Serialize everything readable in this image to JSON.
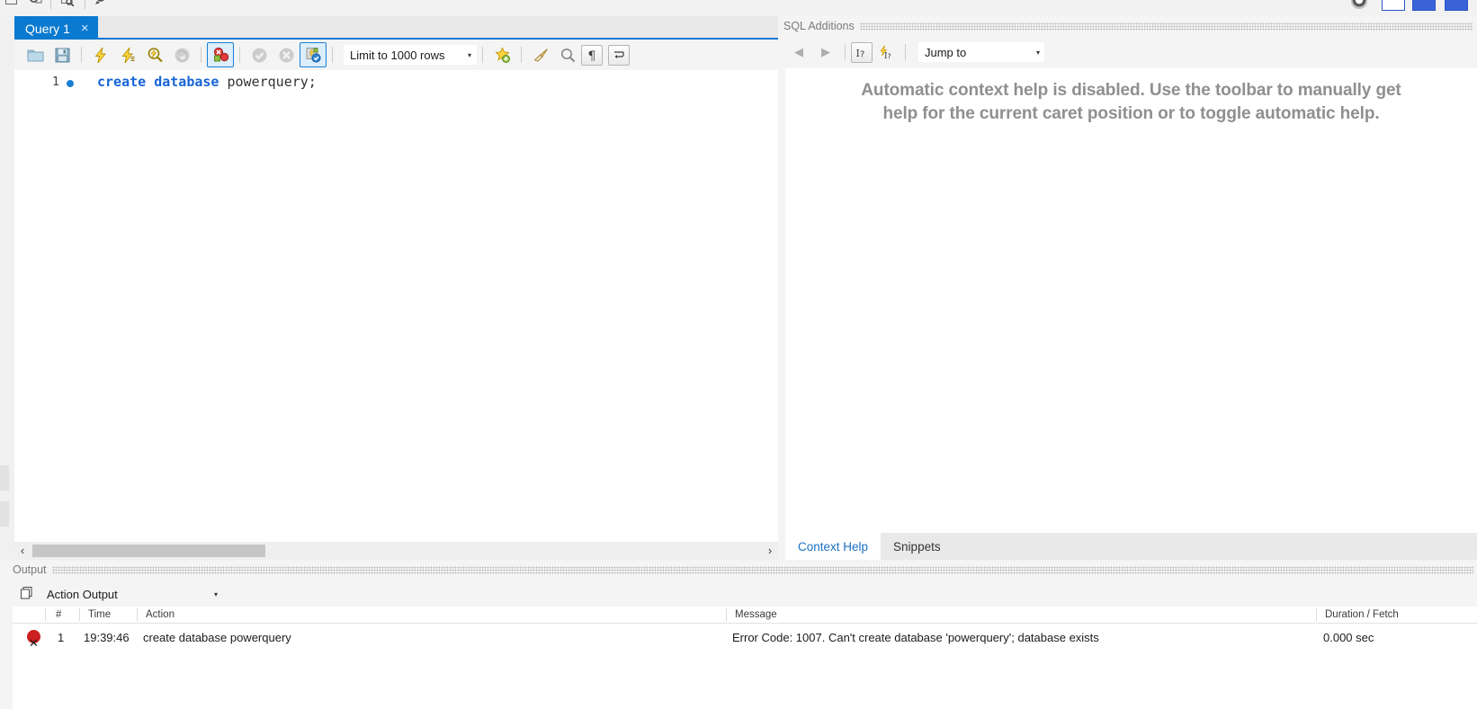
{
  "window": {
    "top_toolbar_icons": [
      "open-icon",
      "save-icon",
      "inspect-icon",
      "search-icon"
    ],
    "window_buttons": [
      "restore-button",
      "maximize-button"
    ]
  },
  "editor_tabs": [
    {
      "label": "Query 1",
      "close": "×",
      "active": true
    }
  ],
  "query_toolbar": {
    "buttons": [
      {
        "name": "open-sql-script-icon",
        "title": "Open a SQL script file"
      },
      {
        "name": "save-script-icon",
        "title": "Save script"
      },
      {
        "name": "execute-statement-icon",
        "title": "Execute"
      },
      {
        "name": "execute-current-statement-icon",
        "title": "Execute current statement"
      },
      {
        "name": "explain-query-icon",
        "title": "Explain current statement"
      },
      {
        "name": "stop-execution-icon",
        "title": "Stop"
      },
      {
        "name": "toggle-stop-on-error-icon",
        "title": "Toggle whether execution should stop on errors",
        "selected": true
      },
      {
        "name": "commit-icon",
        "title": "Commit"
      },
      {
        "name": "rollback-icon",
        "title": "Rollback"
      },
      {
        "name": "toggle-autocommit-icon",
        "title": "Toggle auto-commit mode",
        "selected": true
      },
      {
        "name": "beautify-query-icon",
        "title": "Beautify/reformat the SQL script"
      },
      {
        "name": "find-icon",
        "title": "Show the Find panel"
      },
      {
        "name": "invisible-chars-icon",
        "title": "Toggle invisible characters"
      },
      {
        "name": "wrap-lines-icon",
        "title": "Toggle wrapping of long lines"
      }
    ],
    "limit_selector": {
      "value": "Limit to 1000 rows",
      "caret": "▾"
    }
  },
  "sql_editor": {
    "line_number": "1",
    "code_keywords": "create database",
    "code_identifier": " powerquery;"
  },
  "scrollbar": {
    "left_arrow": "‹",
    "right_arrow": "›"
  },
  "sql_additions": {
    "title": "SQL Additions",
    "toolbar": {
      "back": "◀",
      "forward": "▶",
      "context_help_icon": "context-help-icon",
      "automatic_help_icon": "automatic-context-help-icon",
      "jump_to": {
        "value": "Jump to",
        "caret": "▾"
      }
    },
    "message_line1": "Automatic context help is disabled. Use the toolbar to manually get",
    "message_line2": "help for the current caret position or to toggle automatic help.",
    "tabs": [
      {
        "label": "Context Help",
        "active": true
      },
      {
        "label": "Snippets",
        "active": false
      }
    ]
  },
  "output": {
    "title": "Output",
    "selector": {
      "value": "Action Output",
      "caret": "▾"
    },
    "columns": [
      "#",
      "Time",
      "Action",
      "Message",
      "Duration / Fetch"
    ],
    "rows": [
      {
        "status": "error",
        "status_glyph": "✕",
        "num": "1",
        "time": "19:39:46",
        "action": "create database powerquery",
        "message": "Error Code: 1007. Can't create database 'powerquery'; database exists",
        "duration": "0.000 sec"
      }
    ]
  },
  "colors": {
    "accent": "#0a79d0",
    "keyword": "#1764d8",
    "error": "#cc1f1f",
    "panel": "#f4f4f4"
  }
}
